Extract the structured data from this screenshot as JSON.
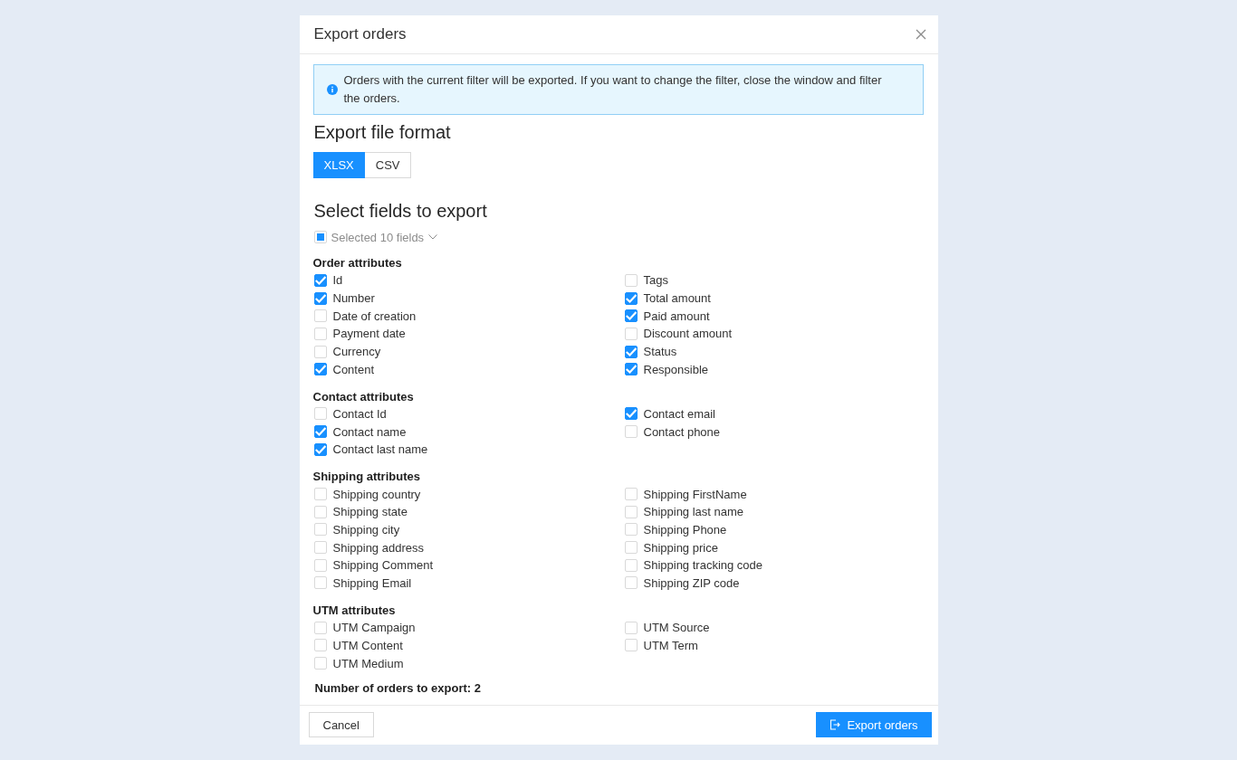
{
  "dialog": {
    "title": "Export orders"
  },
  "info_message": "Orders with the current filter will be exported. If you want to change the filter, close the window and filter the orders.",
  "format_section": {
    "heading": "Export file format",
    "options": [
      {
        "label": "XLSX",
        "selected": true
      },
      {
        "label": "CSV",
        "selected": false
      }
    ]
  },
  "fields_section": {
    "heading": "Select fields to export",
    "select_all": {
      "label": "Selected 10 fields",
      "checked": false,
      "indeterminate": true
    },
    "groups": [
      {
        "title": "Order attributes",
        "columns": [
          [
            {
              "label": "Id",
              "checked": true
            },
            {
              "label": "Number",
              "checked": true
            },
            {
              "label": "Date of creation",
              "checked": false
            },
            {
              "label": "Payment date",
              "checked": false
            },
            {
              "label": "Currency",
              "checked": false
            },
            {
              "label": "Content",
              "checked": true
            }
          ],
          [
            {
              "label": "Tags",
              "checked": false
            },
            {
              "label": "Total amount",
              "checked": true
            },
            {
              "label": "Paid amount",
              "checked": true
            },
            {
              "label": "Discount amount",
              "checked": false
            },
            {
              "label": "Status",
              "checked": true
            },
            {
              "label": "Responsible",
              "checked": true
            }
          ]
        ]
      },
      {
        "title": "Contact attributes",
        "columns": [
          [
            {
              "label": "Contact Id",
              "checked": false
            },
            {
              "label": "Contact name",
              "checked": true
            },
            {
              "label": "Contact last name",
              "checked": true
            }
          ],
          [
            {
              "label": "Contact email",
              "checked": true
            },
            {
              "label": "Contact phone",
              "checked": false
            }
          ]
        ]
      },
      {
        "title": "Shipping attributes",
        "columns": [
          [
            {
              "label": "Shipping country",
              "checked": false
            },
            {
              "label": "Shipping state",
              "checked": false
            },
            {
              "label": "Shipping city",
              "checked": false
            },
            {
              "label": "Shipping address",
              "checked": false
            },
            {
              "label": "Shipping Comment",
              "checked": false
            },
            {
              "label": "Shipping Email",
              "checked": false
            }
          ],
          [
            {
              "label": "Shipping FirstName",
              "checked": false
            },
            {
              "label": "Shipping last name",
              "checked": false
            },
            {
              "label": "Shipping Phone",
              "checked": false
            },
            {
              "label": "Shipping price",
              "checked": false
            },
            {
              "label": "Shipping tracking code",
              "checked": false
            },
            {
              "label": "Shipping ZIP code",
              "checked": false
            }
          ]
        ]
      },
      {
        "title": "UTM attributes",
        "columns": [
          [
            {
              "label": "UTM Campaign",
              "checked": false
            },
            {
              "label": "UTM Content",
              "checked": false
            },
            {
              "label": "UTM Medium",
              "checked": false
            }
          ],
          [
            {
              "label": "UTM Source",
              "checked": false
            },
            {
              "label": "UTM Term",
              "checked": false
            }
          ]
        ]
      }
    ]
  },
  "order_count": "Number of orders to export: 2",
  "buttons": [
    {
      "label": "Cancel",
      "kind": "secondary"
    },
    {
      "label": "Export orders",
      "kind": "primary"
    }
  ]
}
